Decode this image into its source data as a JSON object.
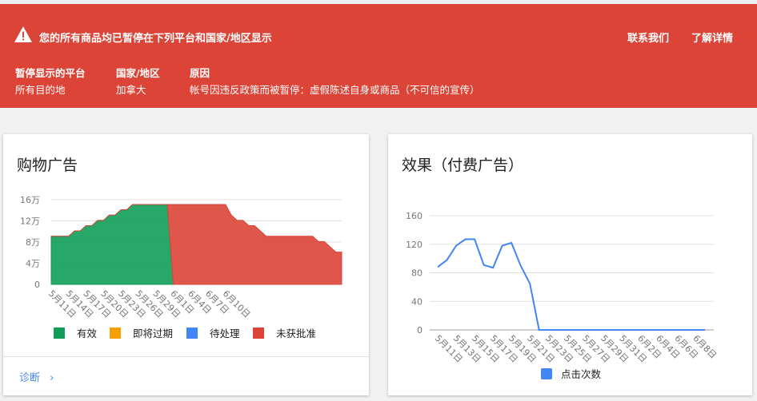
{
  "banner": {
    "message": "您的所有商品均已暂停在下列平台和国家/地区显示",
    "contact_link": "联系我们",
    "details_link": "了解详情",
    "headers": {
      "platform": "暂停显示的平台",
      "country": "国家/地区",
      "reason": "原因"
    },
    "values": {
      "platform": "所有目的地",
      "country": "加拿大",
      "reason": "帐号因违反政策而被暂停：虚假陈述自身或商品（不可信的宣传）"
    },
    "colors": {
      "background": "#db4437"
    }
  },
  "shopping_card": {
    "title": "购物广告",
    "diagnose_link": "诊断",
    "legend": [
      {
        "label": "有效",
        "color": "#0f9d58"
      },
      {
        "label": "即将过期",
        "color": "#f4a000"
      },
      {
        "label": "待处理",
        "color": "#4285f4"
      },
      {
        "label": "未获批准",
        "color": "#db4437"
      }
    ]
  },
  "perf_card": {
    "title": "效果（付费广告）",
    "legend": [
      {
        "label": "点击次数",
        "color": "#4285f4"
      }
    ]
  },
  "chart_data": [
    {
      "type": "area",
      "stacked": true,
      "y_ticks": [
        0,
        4,
        8,
        12,
        16
      ],
      "y_tick_labels": [
        "0",
        "4万",
        "8万",
        "12万",
        "16万"
      ],
      "ylim": [
        0,
        16
      ],
      "x_tick_labels": [
        "5月11日",
        "5月14日",
        "5月17日",
        "5月20日",
        "5月23日",
        "5月26日",
        "5月29日",
        "6月1日",
        "6月4日",
        "6月7日",
        "6月10日"
      ],
      "series": [
        {
          "name": "有效",
          "color": "#0f9d58",
          "values": [
            9.1,
            9.1,
            9.1,
            9.1,
            10.1,
            10.1,
            11.1,
            11.1,
            12.1,
            12.1,
            13.1,
            13.1,
            14.1,
            14.1,
            15.1,
            15.1,
            15.1,
            15.1,
            15.1,
            15.1,
            15.1,
            0,
            0,
            0,
            0,
            0,
            0,
            0,
            0,
            0,
            0,
            0,
            0,
            0,
            0,
            0,
            0,
            0,
            0,
            0,
            0,
            0,
            0,
            0,
            0,
            0,
            0,
            0,
            0,
            0,
            0
          ]
        },
        {
          "name": "未获批准",
          "color": "#db4437",
          "values": [
            0,
            0,
            0,
            0,
            0,
            0,
            0,
            0,
            0,
            0,
            0,
            0,
            0,
            0,
            0,
            0,
            0,
            0,
            0,
            0,
            0,
            15.1,
            15.1,
            15.1,
            15.1,
            15.1,
            15.1,
            15.1,
            15.1,
            15.1,
            15.1,
            13.1,
            12.1,
            12.1,
            11.1,
            11.1,
            10.1,
            9.1,
            9.1,
            9.1,
            9.1,
            9.1,
            9.1,
            9.1,
            9.1,
            9.1,
            8.1,
            8.1,
            7.1,
            6.1,
            6.1
          ]
        }
      ]
    },
    {
      "type": "line",
      "ylim": [
        0,
        160
      ],
      "y_ticks": [
        0,
        40,
        80,
        120,
        160
      ],
      "x_tick_labels": [
        "5月11日",
        "5月13日",
        "5月15日",
        "5月17日",
        "5月19日",
        "5月21日",
        "5月23日",
        "5月25日",
        "5月27日",
        "5月29日",
        "5月31日",
        "6月2日",
        "6月4日",
        "6月6日",
        "6月8日"
      ],
      "series": [
        {
          "name": "点击次数",
          "color": "#4285f4",
          "values": [
            88,
            98,
            118,
            127,
            127,
            91,
            87,
            118,
            122,
            90,
            65,
            0,
            0,
            0,
            0,
            0,
            0,
            0,
            0,
            0,
            0,
            0,
            0,
            0,
            0,
            0,
            0,
            0,
            0,
            0
          ]
        }
      ]
    }
  ]
}
